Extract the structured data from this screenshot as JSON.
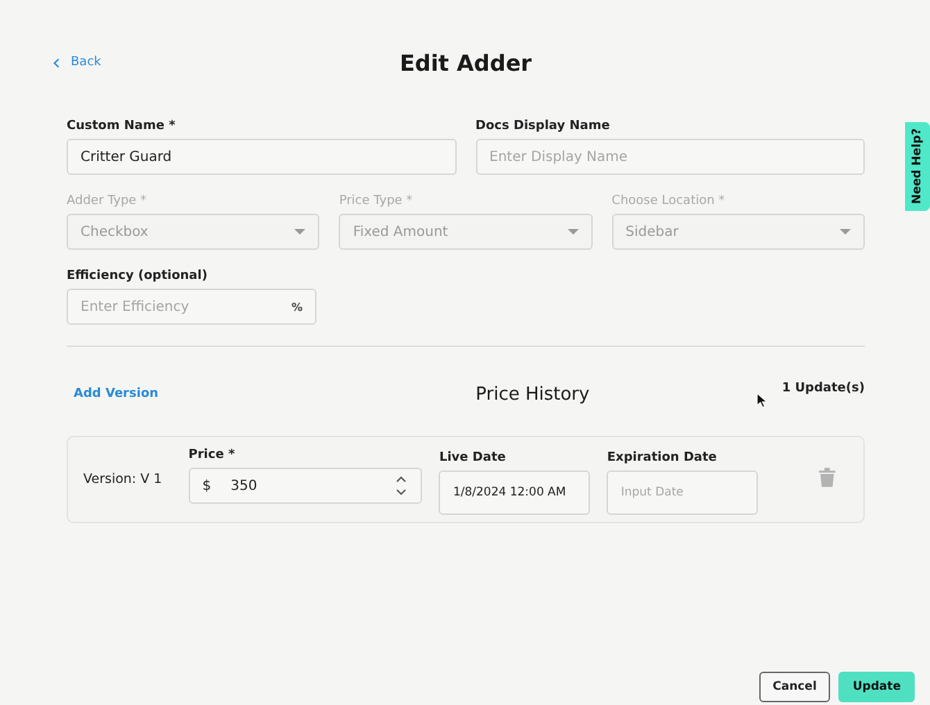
{
  "header": {
    "back": "Back",
    "title": "Edit Adder"
  },
  "form_rows": [
    [
      {
        "kind": "text",
        "label": "Custom Name *",
        "value": "Critter Guard"
      },
      {
        "kind": "text",
        "label": "Docs Display Name",
        "placeholder": "Enter Display Name"
      }
    ],
    [
      {
        "kind": "select",
        "label": "Adder Type *",
        "value": "Checkbox",
        "disabled": true
      },
      {
        "kind": "select",
        "label": "Price Type *",
        "value": "Fixed Amount",
        "disabled": true
      },
      {
        "kind": "select",
        "label": "Choose Location *",
        "value": "Sidebar",
        "disabled": true
      }
    ],
    [
      {
        "kind": "suffix",
        "label": "Efficiency (optional)",
        "placeholder": "Enter Efficiency",
        "suffix": "%"
      }
    ]
  ],
  "price_history": {
    "add_link": "Add Version",
    "title": "Price History",
    "count": "1 Update(s)",
    "versions": [
      {
        "version": "Version: V 1",
        "price_label": "Price *",
        "currency": "$",
        "price": "350",
        "live_label": "Live Date",
        "live_date": "1/8/2024 12:00 AM",
        "expiry_label": "Expiration Date",
        "expiry_placeholder": "Input Date"
      }
    ]
  },
  "help_tab": "Need Help?",
  "buttons": [
    {
      "kind": "secondary",
      "label": "Cancel"
    },
    {
      "kind": "primary",
      "label": "Update"
    }
  ]
}
